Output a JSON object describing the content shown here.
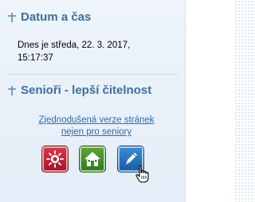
{
  "datetime_section": {
    "title": "Datum a čas",
    "line1": "Dnes je středa, 22. 3. 2017,",
    "line2": "15:17:37"
  },
  "seniors_section": {
    "title": "Senioři - lepší čitelnost",
    "link_line1": "Zjednodušená verze stránek",
    "link_line2": "nejen pro seniory"
  },
  "icons": {
    "section_marker": "cross-icon",
    "buttons": [
      "sun-icon",
      "home-icon",
      "pen-icon"
    ],
    "cursor": "hand-pointer-icon"
  },
  "colors": {
    "heading": "#3d6f9e",
    "link": "#2a6db5",
    "button_red": "#c42236",
    "button_green": "#4a932b",
    "button_blue": "#2a78c4"
  }
}
